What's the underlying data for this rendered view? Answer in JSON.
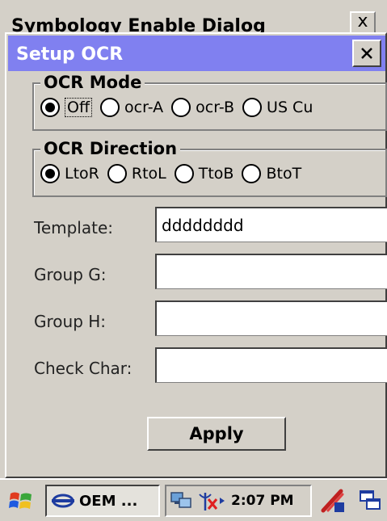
{
  "background_window": {
    "title": "Symbology Enable Dialog",
    "close_label": "x"
  },
  "dialog": {
    "title": "Setup OCR",
    "close_label": "x",
    "ocr_mode": {
      "title": "OCR Mode",
      "options": [
        "Off",
        "ocr-A",
        "ocr-B",
        "US Cu"
      ],
      "selected": "Off"
    },
    "ocr_direction": {
      "title": "OCR Direction",
      "options": [
        "LtoR",
        "RtoL",
        "TtoB",
        "BtoT"
      ],
      "selected": "LtoR"
    },
    "fields": {
      "template_label": "Template:",
      "template_value": "dddddddd",
      "group_g_label": "Group G:",
      "group_g_value": "",
      "group_h_label": "Group H:",
      "group_h_value": "",
      "check_char_label": "Check Char:",
      "check_char_value": ""
    },
    "apply_label": "Apply"
  },
  "taskbar": {
    "task_label": "OEM ...",
    "clock": "2:07 PM"
  },
  "colors": {
    "titlebar": "#8080f0",
    "face": "#d4d0c8"
  }
}
